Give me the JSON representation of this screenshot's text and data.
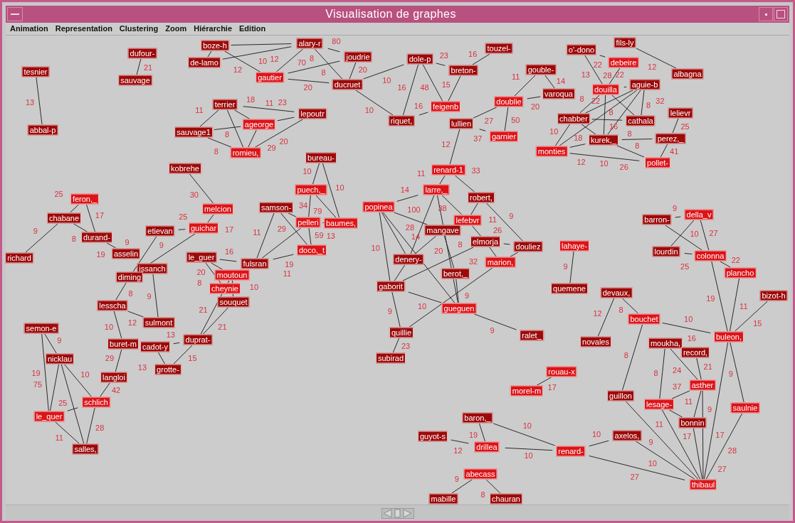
{
  "window": {
    "title": "Visualisation de graphes"
  },
  "menu": [
    {
      "label": "Animation"
    },
    {
      "label": "Representation"
    },
    {
      "label": "Clustering"
    },
    {
      "label": "Zoom"
    },
    {
      "label": "Hiérarchie"
    },
    {
      "label": "Edition"
    }
  ],
  "graph": {
    "nodes": [
      {
        "label": "tesnier",
        "color": "#9c0a0a"
      },
      {
        "label": "abbal-p",
        "color": "#9c0a0a"
      },
      {
        "label": "dufour-",
        "color": "#9c0a0a"
      },
      {
        "label": "sauvage",
        "color": "#9c0a0a"
      },
      {
        "label": "boze-h",
        "color": "#9c0a0a"
      },
      {
        "label": "de-lamo",
        "color": "#9c0a0a"
      },
      {
        "label": "alary-r",
        "color": "#9c0a0a"
      },
      {
        "label": "joudrie",
        "color": "#9c0a0a"
      },
      {
        "label": "gautier",
        "color": "#dc1418"
      },
      {
        "label": "ducruet",
        "color": "#9c0a0a"
      },
      {
        "label": "dole-p",
        "color": "#9c0a0a"
      },
      {
        "label": "breton-",
        "color": "#9c0a0a"
      },
      {
        "label": "touzel-",
        "color": "#9c0a0a"
      },
      {
        "label": "riquet,",
        "color": "#9c0a0a"
      },
      {
        "label": "feigenb",
        "color": "#dc1418"
      },
      {
        "label": "lullien",
        "color": "#9c0a0a"
      },
      {
        "label": "doublie",
        "color": "#dc1418"
      },
      {
        "label": "garnier",
        "color": "#dc1418"
      },
      {
        "label": "gouble-",
        "color": "#9c0a0a"
      },
      {
        "label": "varoqua",
        "color": "#9c0a0a"
      },
      {
        "label": "terrier",
        "color": "#9c0a0a"
      },
      {
        "label": "lepoutr",
        "color": "#9c0a0a"
      },
      {
        "label": "ageorge",
        "color": "#dc1418"
      },
      {
        "label": "sauvage1",
        "color": "#9c0a0a"
      },
      {
        "label": "romieu,",
        "color": "#dc1418"
      },
      {
        "label": "fils-ly",
        "color": "#9c0a0a"
      },
      {
        "label": "o'-dono",
        "color": "#9c0a0a"
      },
      {
        "label": "debeire",
        "color": "#dc1418"
      },
      {
        "label": "albagna",
        "color": "#9c0a0a"
      },
      {
        "label": "douilla",
        "color": "#dc1418"
      },
      {
        "label": "aguie-b",
        "color": "#9c0a0a"
      },
      {
        "label": "chabber",
        "color": "#9c0a0a"
      },
      {
        "label": "cathala",
        "color": "#9c0a0a"
      },
      {
        "label": "lelievr",
        "color": "#9c0a0a"
      },
      {
        "label": "kurek,_",
        "color": "#9c0a0a"
      },
      {
        "label": "perez,_",
        "color": "#9c0a0a"
      },
      {
        "label": "monties",
        "color": "#dc1418"
      },
      {
        "label": "pollet-",
        "color": "#dc1418"
      },
      {
        "label": "bureau-",
        "color": "#9c0a0a"
      },
      {
        "label": "puech,_",
        "color": "#dc1418"
      },
      {
        "label": "samson-",
        "color": "#9c0a0a"
      },
      {
        "label": "pelleri",
        "color": "#dc1418"
      },
      {
        "label": "baumes,",
        "color": "#dc1418"
      },
      {
        "label": "doco,_t",
        "color": "#dc1418"
      },
      {
        "label": "kobrehe",
        "color": "#9c0a0a"
      },
      {
        "label": "melcion",
        "color": "#dc1418"
      },
      {
        "label": "feron,_",
        "color": "#dc1418"
      },
      {
        "label": "chabane",
        "color": "#9c0a0a"
      },
      {
        "label": "durand-",
        "color": "#9c0a0a"
      },
      {
        "label": "asselin",
        "color": "#9c0a0a"
      },
      {
        "label": "richard",
        "color": "#9c0a0a"
      },
      {
        "label": "etievan",
        "color": "#9c0a0a"
      },
      {
        "label": "guichar",
        "color": "#dc1418"
      },
      {
        "label": "le_guer",
        "color": "#9c0a0a"
      },
      {
        "label": "fulsran",
        "color": "#9c0a0a"
      },
      {
        "label": "moutoun",
        "color": "#dc1418"
      },
      {
        "label": "cheynie",
        "color": "#dc1418"
      },
      {
        "label": "souquet",
        "color": "#9c0a0a"
      },
      {
        "label": "issanch",
        "color": "#9c0a0a"
      },
      {
        "label": "diming",
        "color": "#9c0a0a"
      },
      {
        "label": "lesscha",
        "color": "#9c0a0a"
      },
      {
        "label": "sulmont",
        "color": "#9c0a0a"
      },
      {
        "label": "semon-e",
        "color": "#9c0a0a"
      },
      {
        "label": "buret-m",
        "color": "#9c0a0a"
      },
      {
        "label": "cadot-y",
        "color": "#9c0a0a"
      },
      {
        "label": "duprat-",
        "color": "#9c0a0a"
      },
      {
        "label": "grotte-",
        "color": "#9c0a0a"
      },
      {
        "label": "nicklau",
        "color": "#9c0a0a"
      },
      {
        "label": "langloi",
        "color": "#9c0a0a"
      },
      {
        "label": "schlich",
        "color": "#dc1418"
      },
      {
        "label": "le_quer",
        "color": "#dc1418"
      },
      {
        "label": "salles,",
        "color": "#9c0a0a"
      },
      {
        "label": "renard-1",
        "color": "#dc1418"
      },
      {
        "label": "larre,_",
        "color": "#dc1418"
      },
      {
        "label": "robert,",
        "color": "#9c0a0a"
      },
      {
        "label": "popinea",
        "color": "#dc1418"
      },
      {
        "label": "lefebvr",
        "color": "#dc1418"
      },
      {
        "label": "mangave",
        "color": "#9c0a0a"
      },
      {
        "label": "elmorja",
        "color": "#9c0a0a"
      },
      {
        "label": "douliez",
        "color": "#9c0a0a"
      },
      {
        "label": "denery-",
        "color": "#9c0a0a"
      },
      {
        "label": "marion,",
        "color": "#dc1418"
      },
      {
        "label": "berot,_",
        "color": "#9c0a0a"
      },
      {
        "label": "gaborit",
        "color": "#9c0a0a"
      },
      {
        "label": "gueguen",
        "color": "#dc1418"
      },
      {
        "label": "quillie",
        "color": "#9c0a0a"
      },
      {
        "label": "subirad",
        "color": "#9c0a0a"
      },
      {
        "label": "ralet_",
        "color": "#9c0a0a"
      },
      {
        "label": "lahaye-",
        "color": "#dc1418"
      },
      {
        "label": "quemene",
        "color": "#9c0a0a"
      },
      {
        "label": "devaux,",
        "color": "#9c0a0a"
      },
      {
        "label": "novales",
        "color": "#9c0a0a"
      },
      {
        "label": "bouchet",
        "color": "#dc1418"
      },
      {
        "label": "buleon,",
        "color": "#dc1418"
      },
      {
        "label": "bizot-h",
        "color": "#9c0a0a"
      },
      {
        "label": "barron-",
        "color": "#9c0a0a"
      },
      {
        "label": "della_v",
        "color": "#dc1418"
      },
      {
        "label": "lourdin",
        "color": "#9c0a0a"
      },
      {
        "label": "colonna",
        "color": "#dc1418"
      },
      {
        "label": "plancho",
        "color": "#dc1418"
      },
      {
        "label": "moukha,",
        "color": "#9c0a0a"
      },
      {
        "label": "record,",
        "color": "#9c0a0a"
      },
      {
        "label": "asther",
        "color": "#dc1418"
      },
      {
        "label": "guillon",
        "color": "#9c0a0a"
      },
      {
        "label": "lesage-",
        "color": "#dc1418"
      },
      {
        "label": "bonnin",
        "color": "#9c0a0a"
      },
      {
        "label": "saulnie",
        "color": "#dc1418"
      },
      {
        "label": "rouau-x",
        "color": "#dc1418"
      },
      {
        "label": "morel-m",
        "color": "#dc1418"
      },
      {
        "label": "baron,_",
        "color": "#9c0a0a"
      },
      {
        "label": "guyot-s",
        "color": "#9c0a0a"
      },
      {
        "label": "drillea",
        "color": "#dc1418"
      },
      {
        "label": "renard-",
        "color": "#dc1418"
      },
      {
        "label": "axelos,",
        "color": "#9c0a0a"
      },
      {
        "label": "thibaul",
        "color": "#dc1418"
      },
      {
        "label": "abecass",
        "color": "#dc1418"
      },
      {
        "label": "mabille",
        "color": "#9c0a0a"
      },
      {
        "label": "chauran",
        "color": "#9c0a0a"
      }
    ],
    "edge_weights": [
      "13",
      "21",
      "10",
      "12",
      "12",
      "70",
      "80",
      "8",
      "8",
      "20",
      "20",
      "10",
      "10",
      "16",
      "23",
      "48",
      "15",
      "16",
      "16",
      "11",
      "27",
      "50",
      "37",
      "20",
      "14",
      "12",
      "11",
      "18",
      "11",
      "8",
      "8",
      "23",
      "29",
      "20",
      "12",
      "13",
      "22",
      "28",
      "22",
      "8",
      "8",
      "8",
      "22",
      "8",
      "32",
      "16",
      "10",
      "18",
      "8",
      "26",
      "12",
      "10",
      "25",
      "41",
      "10",
      "10",
      "34",
      "79",
      "29",
      "59",
      "13",
      "11",
      "19",
      "11",
      "30",
      "17",
      "25",
      "9",
      "9",
      "25",
      "17",
      "8",
      "9",
      "19",
      "16",
      "20",
      "8",
      "10",
      "9",
      "8",
      "12",
      "10",
      "29",
      "9",
      "19",
      "75",
      "10",
      "42",
      "25",
      "28",
      "11",
      "21",
      "21",
      "13",
      "13",
      "15",
      "11",
      "33",
      "14",
      "38",
      "20",
      "11",
      "9",
      "100",
      "28",
      "10",
      "8",
      "14",
      "26",
      "32",
      "10",
      "9",
      "9",
      "9",
      "23",
      "9",
      "12",
      "8",
      "10",
      "8",
      "9",
      "10",
      "27",
      "25",
      "22",
      "19",
      "11",
      "15",
      "9",
      "9",
      "8",
      "24",
      "16",
      "21",
      "37",
      "11",
      "17",
      "11",
      "17",
      "27",
      "28",
      "9",
      "10",
      "10",
      "27",
      "10",
      "19",
      "12",
      "10",
      "17",
      "9",
      "8"
    ]
  }
}
